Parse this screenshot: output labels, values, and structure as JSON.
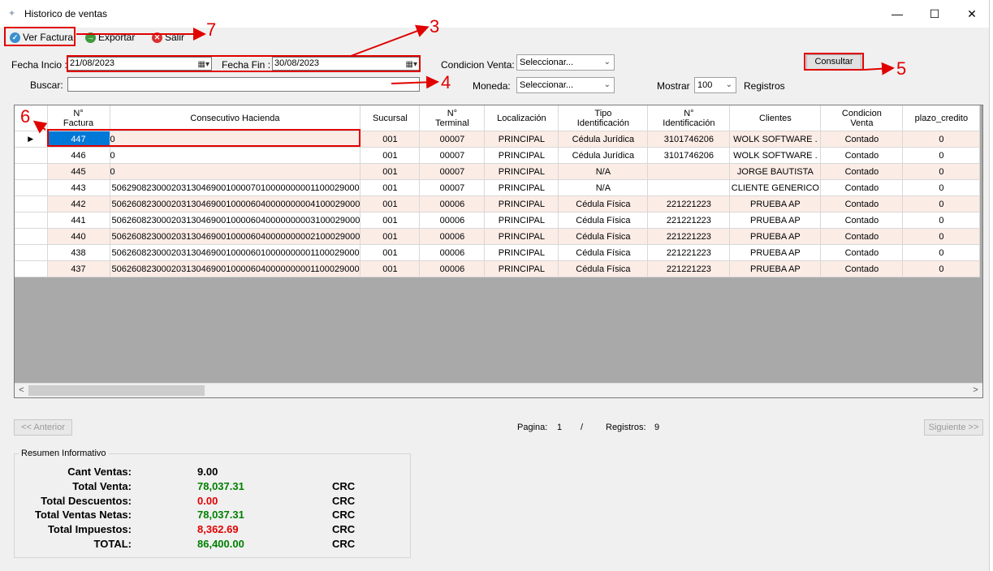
{
  "window": {
    "title": "Historico de ventas",
    "minimize": "—",
    "maximize": "☐",
    "close": "✕"
  },
  "toolbar": {
    "ver_factura": "Ver Factura",
    "exportar": "Exportar",
    "salir": "Salir"
  },
  "filters": {
    "fecha_inicio_label": "Fecha Incio :",
    "fecha_inicio_value": "21/08/2023",
    "fecha_fin_label": "Fecha Fin :",
    "fecha_fin_value": "30/08/2023",
    "buscar_label": "Buscar:",
    "buscar_value": "",
    "condicion_label": "Condicion Venta:",
    "condicion_value": "Seleccionar...",
    "moneda_label": "Moneda:",
    "moneda_value": "Seleccionar...",
    "mostrar_label": "Mostrar",
    "mostrar_value": "100",
    "registros_label": "Registros",
    "consultar": "Consultar"
  },
  "grid": {
    "columns": [
      "N°\nFactura",
      "Consecutivo Hacienda",
      "Sucursal",
      "N°\nTerminal",
      "Localización",
      "Tipo\nIdentificación",
      "N°\nIdentificación",
      "Clientes",
      "Condicion\nVenta",
      "plazo_credito"
    ],
    "rows": [
      [
        "447",
        "0",
        "001",
        "00007",
        "PRINCIPAL",
        "Cédula Jurídica",
        "3101746206",
        "WOLK SOFTWARE .",
        "Contado",
        "0"
      ],
      [
        "446",
        "0",
        "001",
        "00007",
        "PRINCIPAL",
        "Cédula Jurídica",
        "3101746206",
        "WOLK SOFTWARE .",
        "Contado",
        "0"
      ],
      [
        "445",
        "0",
        "001",
        "00007",
        "PRINCIPAL",
        "N/A",
        "",
        "JORGE BAUTISTA",
        "Contado",
        "0"
      ],
      [
        "443",
        "50629082300020313046900100007010000000001100029000",
        "001",
        "00007",
        "PRINCIPAL",
        "N/A",
        "",
        "CLIENTE GENERICO",
        "Contado",
        "0"
      ],
      [
        "442",
        "50626082300020313046900100006040000000004100029000",
        "001",
        "00006",
        "PRINCIPAL",
        "Cédula Física",
        "221221223",
        "PRUEBA AP",
        "Contado",
        "0"
      ],
      [
        "441",
        "50626082300020313046900100006040000000003100029000",
        "001",
        "00006",
        "PRINCIPAL",
        "Cédula Física",
        "221221223",
        "PRUEBA AP",
        "Contado",
        "0"
      ],
      [
        "440",
        "50626082300020313046900100006040000000002100029000",
        "001",
        "00006",
        "PRINCIPAL",
        "Cédula Física",
        "221221223",
        "PRUEBA AP",
        "Contado",
        "0"
      ],
      [
        "438",
        "50626082300020313046900100006010000000001100029000",
        "001",
        "00006",
        "PRINCIPAL",
        "Cédula Física",
        "221221223",
        "PRUEBA AP",
        "Contado",
        "0"
      ],
      [
        "437",
        "50626082300020313046900100006040000000001100029000",
        "001",
        "00006",
        "PRINCIPAL",
        "Cédula Física",
        "221221223",
        "PRUEBA AP",
        "Contado",
        "0"
      ]
    ],
    "scroll_left": "<",
    "scroll_right": ">"
  },
  "pagination": {
    "anterior": "<< Anterior",
    "pagina_label": "Pagina:",
    "pagina_value": "1",
    "sep": "/",
    "registros_label": "Registros:",
    "registros_value": "9",
    "siguiente": "Siguiente >>"
  },
  "summary": {
    "legend": "Resumen Informativo",
    "rows": [
      {
        "label": "Cant Ventas:",
        "value": "9.00",
        "currency": "",
        "color": "#000000"
      },
      {
        "label": "Total Venta:",
        "value": "78,037.31",
        "currency": "CRC",
        "color": "#008000"
      },
      {
        "label": "Total Descuentos:",
        "value": "0.00",
        "currency": "CRC",
        "color": "#e00000"
      },
      {
        "label": "Total Ventas Netas:",
        "value": "78,037.31",
        "currency": "CRC",
        "color": "#008000"
      },
      {
        "label": "Total Impuestos:",
        "value": "8,362.69",
        "currency": "CRC",
        "color": "#e00000"
      },
      {
        "label": "TOTAL:",
        "value": "86,400.00",
        "currency": "CRC",
        "color": "#008000"
      }
    ]
  },
  "annotations": {
    "n3": "3",
    "n4": "4",
    "n5": "5",
    "n6": "6",
    "n7": "7",
    "color": "#e00000"
  }
}
